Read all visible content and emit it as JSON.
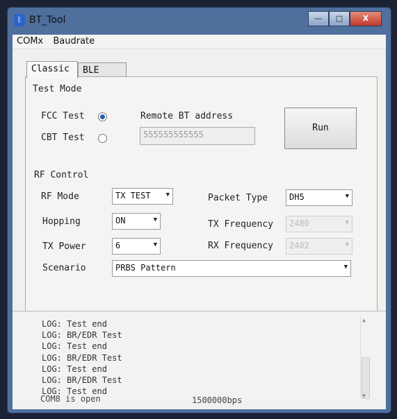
{
  "window": {
    "title": "BT_Tool",
    "app_icon": "bluetooth-icon",
    "controls": {
      "minimize": "—",
      "maximize": "□",
      "close": "X"
    }
  },
  "menu": {
    "items": [
      "COMx",
      "Baudrate"
    ]
  },
  "tabs": [
    "Classic",
    "BLE"
  ],
  "test_mode": {
    "heading": "Test Mode",
    "fcc_label": "FCC Test",
    "cbt_label": "CBT Test",
    "selected": "FCC Test",
    "remote_label": "Remote BT address",
    "remote_value": "555555555555",
    "run_label": "Run"
  },
  "rf_control": {
    "heading": "RF Control",
    "rf_mode_label": "RF Mode",
    "rf_mode_value": "TX TEST",
    "packet_type_label": "Packet Type",
    "packet_type_value": "DH5",
    "hopping_label": "Hopping",
    "hopping_value": "ON",
    "tx_freq_label": "TX Frequency",
    "tx_freq_value": "2480",
    "tx_power_label": "TX Power",
    "tx_power_value": "6",
    "rx_freq_label": "RX Frequency",
    "rx_freq_value": "2402",
    "scenario_label": "Scenario",
    "scenario_value": "PRBS Pattern"
  },
  "log": {
    "lines": [
      "LOG: Test end",
      "LOG: BR/EDR Test",
      "LOG: Test end",
      "LOG: BR/EDR Test",
      "LOG: Test end",
      "LOG: BR/EDR Test",
      "LOG: Test end"
    ]
  },
  "status": {
    "port": "COM8 is open",
    "baud": "1500000bps"
  }
}
